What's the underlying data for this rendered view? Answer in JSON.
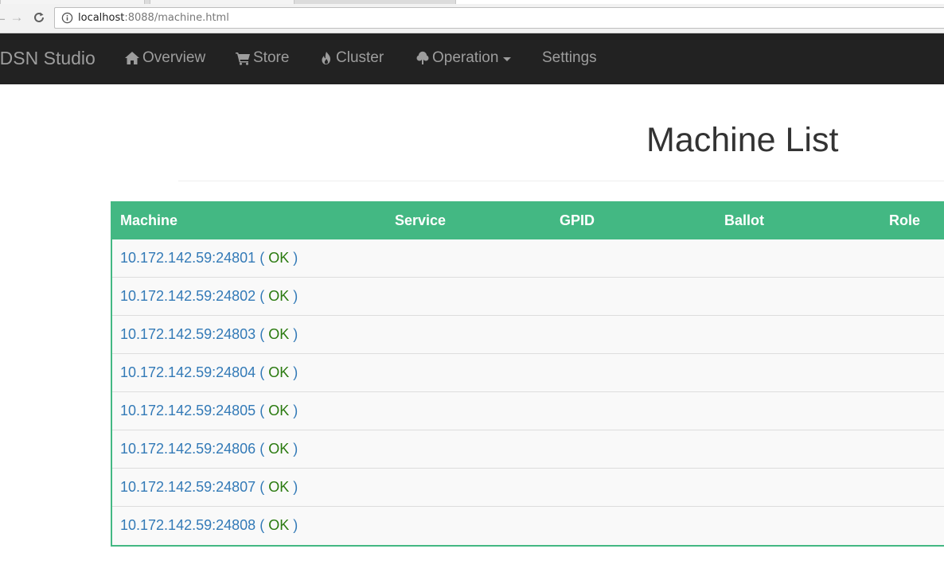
{
  "browser": {
    "url_host": "localhost",
    "url_rest": ":8088/machine.html"
  },
  "navbar": {
    "brand": "rDSN Studio",
    "items": [
      {
        "label": "Overview",
        "icon": "home-icon"
      },
      {
        "label": "Store",
        "icon": "shopping-cart-icon"
      },
      {
        "label": "Cluster",
        "icon": "fire-icon"
      },
      {
        "label": "Operation",
        "icon": "tree-icon",
        "dropdown": true
      },
      {
        "label": "Settings"
      }
    ]
  },
  "page": {
    "title": "Machine List"
  },
  "table": {
    "columns": [
      "Machine",
      "Service",
      "GPID",
      "Ballot",
      "Role"
    ],
    "header_color": "#43b883",
    "rows": [
      {
        "machine": "10.172.142.59:24801",
        "status": "OK"
      },
      {
        "machine": "10.172.142.59:24802",
        "status": "OK"
      },
      {
        "machine": "10.172.142.59:24803",
        "status": "OK"
      },
      {
        "machine": "10.172.142.59:24804",
        "status": "OK"
      },
      {
        "machine": "10.172.142.59:24805",
        "status": "OK"
      },
      {
        "machine": "10.172.142.59:24806",
        "status": "OK"
      },
      {
        "machine": "10.172.142.59:24807",
        "status": "OK"
      },
      {
        "machine": "10.172.142.59:24808",
        "status": "OK"
      }
    ],
    "paren_open": "(",
    "paren_close": ")"
  }
}
